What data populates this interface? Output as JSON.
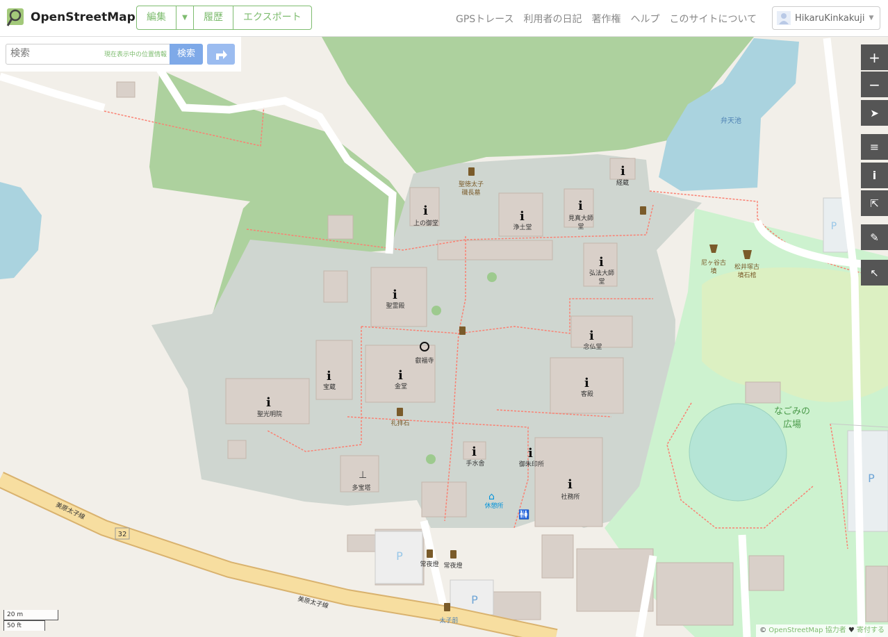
{
  "header": {
    "logo_text": "OpenStreetMap",
    "edit_label": "編集",
    "history_label": "履歴",
    "export_label": "エクスポート",
    "nav": [
      "GPSトレース",
      "利用者の日記",
      "著作権",
      "ヘルプ",
      "このサイトについて"
    ],
    "username": "HikaruKinkakuji"
  },
  "search": {
    "placeholder": "検索",
    "where_label": "現在表示中の位置情報",
    "button_label": "検索"
  },
  "controls": [
    "zoom-in",
    "zoom-out",
    "geolocate",
    "layers",
    "info",
    "share",
    "note",
    "query"
  ],
  "map": {
    "labels": {
      "shotoku": "聖徳太子",
      "shotoku2": "磯長墓",
      "kyozo": "経蔵",
      "kaminomido": "上の御堂",
      "jododo": "浄土堂",
      "kenshin": "見真大師",
      "kenshin2": "堂",
      "kobo": "弘法大師",
      "kobo2": "堂",
      "benten": "弁天池",
      "nigatani": "尼ヶ谷古",
      "nigatani2": "墳",
      "matsui": "松井塚古",
      "matsui2": "墳石棺",
      "seireiden": "聖霊殿",
      "eifukuji": "叡福寺",
      "nenbutsudo": "念仏堂",
      "homotsu": "宝蔵",
      "kondo": "金堂",
      "kyakuden": "客殿",
      "shokomyoin": "聖光明院",
      "raihaiseki": "礼拝石",
      "nagomi": "なごみの",
      "nagomi2": "広場",
      "chozuya": "手水舎",
      "goshuin": "御朱印所",
      "tahoto": "多宝塔",
      "kyukeijo": "休憩所",
      "shamusho": "社務所",
      "road1": "美原太子線",
      "road2": "美原太子線",
      "route": "32",
      "joyato1": "常夜燈",
      "joyato2": "常夜燈",
      "taishimae": "太子前",
      "parking": "P"
    }
  },
  "scale": {
    "metric": "20 m",
    "imperial": "50 ft"
  },
  "attribution": {
    "prefix": "©",
    "osm": "OpenStreetMap",
    "contrib": "協力者",
    "heart": "♥",
    "donate": "寄付する"
  }
}
